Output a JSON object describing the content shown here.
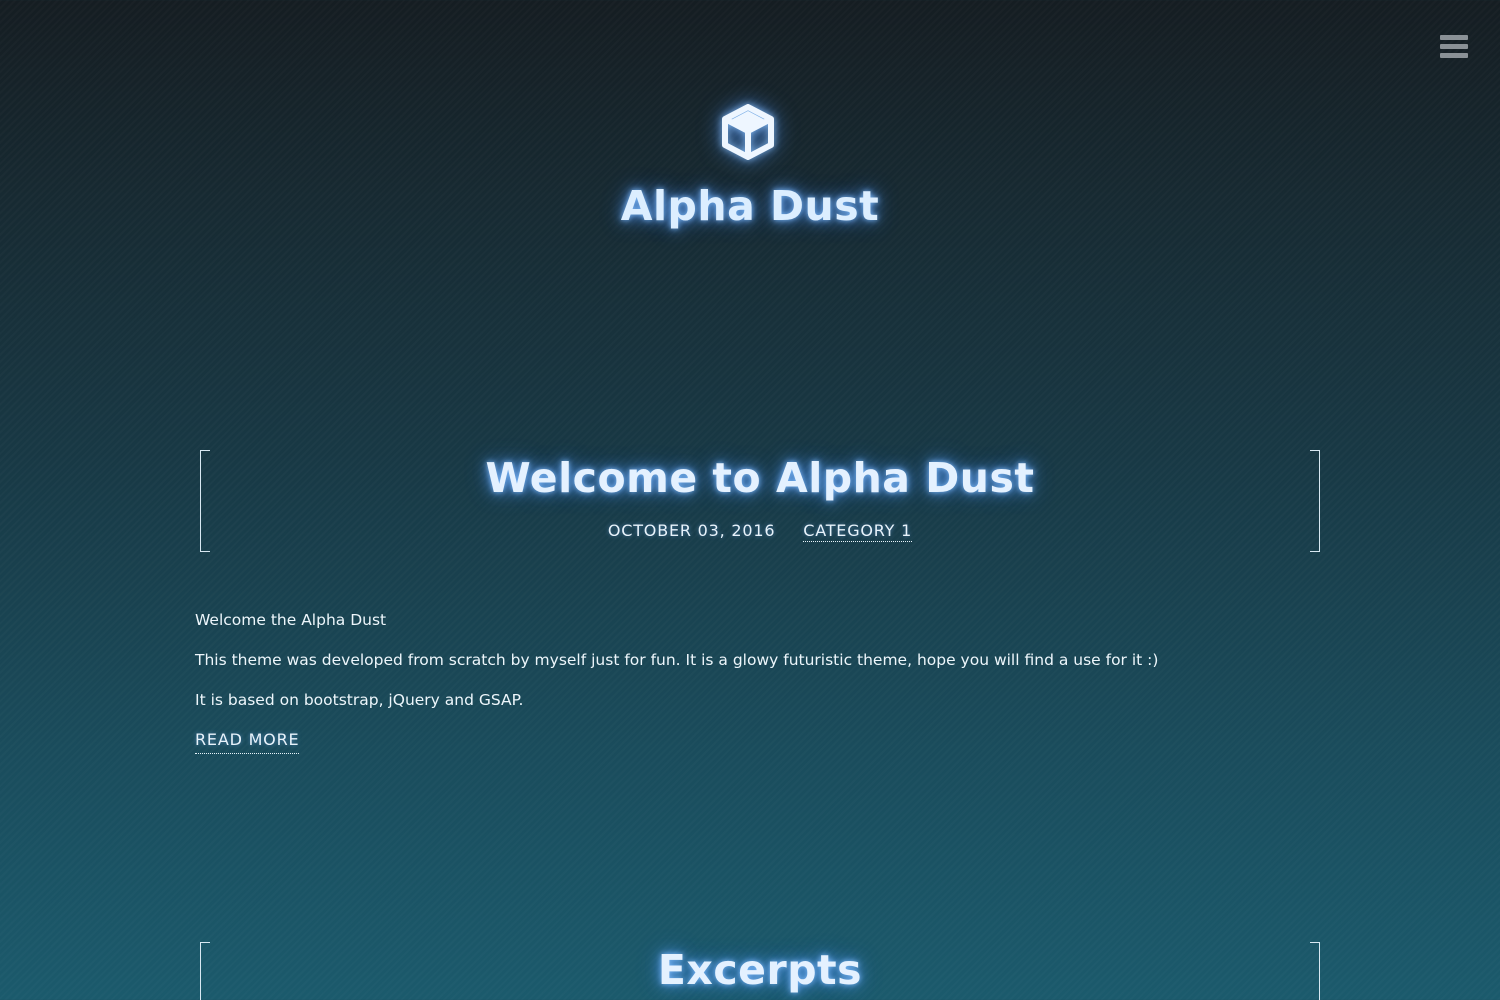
{
  "header": {
    "site_title": "Alpha Dust",
    "logo_icon": "cube-icon",
    "menu_icon": "hamburger-menu-icon"
  },
  "posts": [
    {
      "title": "Welcome to Alpha Dust",
      "date": "OCTOBER 03, 2016",
      "category": "CATEGORY 1",
      "paragraphs": [
        "Welcome the Alpha Dust",
        "This theme was developed from scratch by myself just for fun. It is a glowy futuristic theme, hope you will find a use for it :)",
        "It is based on bootstrap, jQuery and GSAP."
      ],
      "read_more": "READ MORE"
    },
    {
      "title": "Excerpts"
    }
  ],
  "colors": {
    "background_top": "#151d22",
    "background_bottom": "#1b5a6c",
    "glow": "#5aa0ff",
    "text": "#e9f4fb",
    "menu_icon": "#8a9196"
  }
}
